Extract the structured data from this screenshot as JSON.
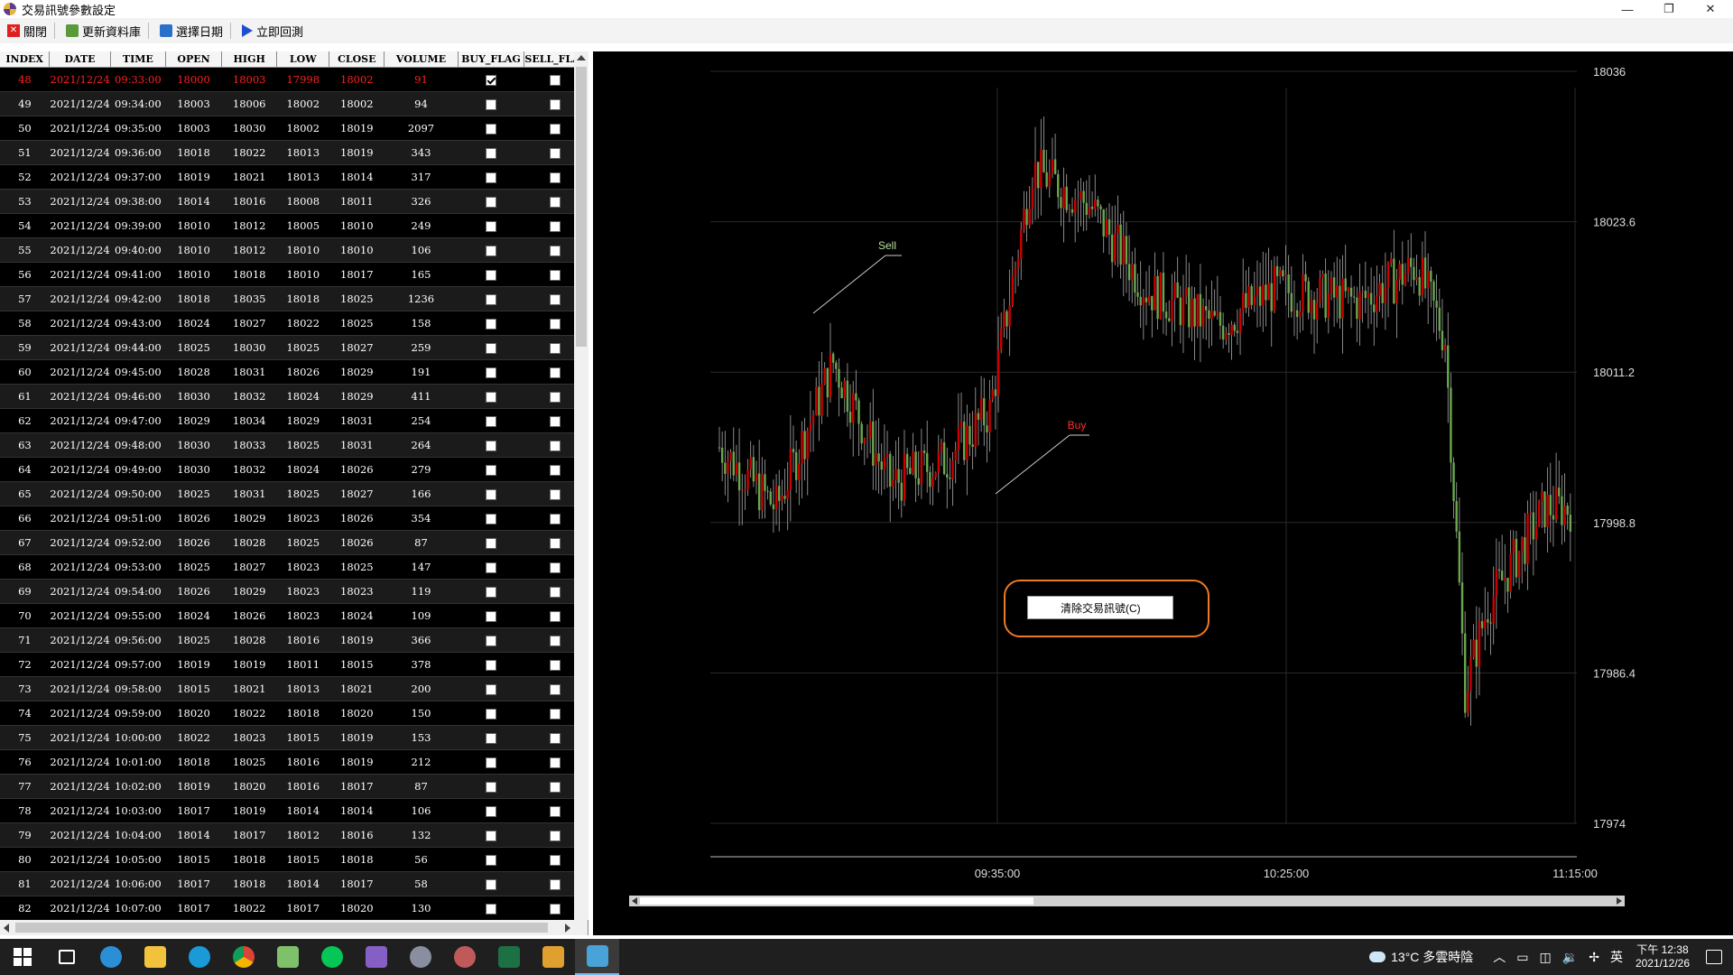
{
  "window": {
    "title": "交易訊號參數設定"
  },
  "toolbar": {
    "close_label": "關閉",
    "update_label": "更新資料庫",
    "date_label": "選擇日期",
    "backtest_label": "立即回測"
  },
  "table": {
    "columns": [
      "INDEX",
      "DATE",
      "TIME",
      "OPEN",
      "HIGH",
      "LOW",
      "CLOSE",
      "VOLUME",
      "BUY_FLAG",
      "SELL_FLAG"
    ],
    "rows": [
      [
        "48",
        "2021/12/24",
        "09:33:00",
        "18000",
        "18003",
        "17998",
        "18002",
        "91",
        true,
        false
      ],
      [
        "49",
        "2021/12/24",
        "09:34:00",
        "18003",
        "18006",
        "18002",
        "18002",
        "94",
        false,
        false
      ],
      [
        "50",
        "2021/12/24",
        "09:35:00",
        "18003",
        "18030",
        "18002",
        "18019",
        "2097",
        false,
        false
      ],
      [
        "51",
        "2021/12/24",
        "09:36:00",
        "18018",
        "18022",
        "18013",
        "18019",
        "343",
        false,
        false
      ],
      [
        "52",
        "2021/12/24",
        "09:37:00",
        "18019",
        "18021",
        "18013",
        "18014",
        "317",
        false,
        false
      ],
      [
        "53",
        "2021/12/24",
        "09:38:00",
        "18014",
        "18016",
        "18008",
        "18011",
        "326",
        false,
        false
      ],
      [
        "54",
        "2021/12/24",
        "09:39:00",
        "18010",
        "18012",
        "18005",
        "18010",
        "249",
        false,
        false
      ],
      [
        "55",
        "2021/12/24",
        "09:40:00",
        "18010",
        "18012",
        "18010",
        "18010",
        "106",
        false,
        false
      ],
      [
        "56",
        "2021/12/24",
        "09:41:00",
        "18010",
        "18018",
        "18010",
        "18017",
        "165",
        false,
        false
      ],
      [
        "57",
        "2021/12/24",
        "09:42:00",
        "18018",
        "18035",
        "18018",
        "18025",
        "1236",
        false,
        false
      ],
      [
        "58",
        "2021/12/24",
        "09:43:00",
        "18024",
        "18027",
        "18022",
        "18025",
        "158",
        false,
        false
      ],
      [
        "59",
        "2021/12/24",
        "09:44:00",
        "18025",
        "18030",
        "18025",
        "18027",
        "259",
        false,
        false
      ],
      [
        "60",
        "2021/12/24",
        "09:45:00",
        "18028",
        "18031",
        "18026",
        "18029",
        "191",
        false,
        false
      ],
      [
        "61",
        "2021/12/24",
        "09:46:00",
        "18030",
        "18032",
        "18024",
        "18029",
        "411",
        false,
        false
      ],
      [
        "62",
        "2021/12/24",
        "09:47:00",
        "18029",
        "18034",
        "18029",
        "18031",
        "254",
        false,
        false
      ],
      [
        "63",
        "2021/12/24",
        "09:48:00",
        "18030",
        "18033",
        "18025",
        "18031",
        "264",
        false,
        false
      ],
      [
        "64",
        "2021/12/24",
        "09:49:00",
        "18030",
        "18032",
        "18024",
        "18026",
        "279",
        false,
        false
      ],
      [
        "65",
        "2021/12/24",
        "09:50:00",
        "18025",
        "18031",
        "18025",
        "18027",
        "166",
        false,
        false
      ],
      [
        "66",
        "2021/12/24",
        "09:51:00",
        "18026",
        "18029",
        "18023",
        "18026",
        "354",
        false,
        false
      ],
      [
        "67",
        "2021/12/24",
        "09:52:00",
        "18026",
        "18028",
        "18025",
        "18026",
        "87",
        false,
        false
      ],
      [
        "68",
        "2021/12/24",
        "09:53:00",
        "18025",
        "18027",
        "18023",
        "18025",
        "147",
        false,
        false
      ],
      [
        "69",
        "2021/12/24",
        "09:54:00",
        "18026",
        "18029",
        "18023",
        "18023",
        "119",
        false,
        false
      ],
      [
        "70",
        "2021/12/24",
        "09:55:00",
        "18024",
        "18026",
        "18023",
        "18024",
        "109",
        false,
        false
      ],
      [
        "71",
        "2021/12/24",
        "09:56:00",
        "18025",
        "18028",
        "18016",
        "18019",
        "366",
        false,
        false
      ],
      [
        "72",
        "2021/12/24",
        "09:57:00",
        "18019",
        "18019",
        "18011",
        "18015",
        "378",
        false,
        false
      ],
      [
        "73",
        "2021/12/24",
        "09:58:00",
        "18015",
        "18021",
        "18013",
        "18021",
        "200",
        false,
        false
      ],
      [
        "74",
        "2021/12/24",
        "09:59:00",
        "18020",
        "18022",
        "18018",
        "18020",
        "150",
        false,
        false
      ],
      [
        "75",
        "2021/12/24",
        "10:00:00",
        "18022",
        "18023",
        "18015",
        "18019",
        "153",
        false,
        false
      ],
      [
        "76",
        "2021/12/24",
        "10:01:00",
        "18018",
        "18025",
        "18016",
        "18019",
        "212",
        false,
        false
      ],
      [
        "77",
        "2021/12/24",
        "10:02:00",
        "18019",
        "18020",
        "18016",
        "18017",
        "87",
        false,
        false
      ],
      [
        "78",
        "2021/12/24",
        "10:03:00",
        "18017",
        "18019",
        "18014",
        "18014",
        "106",
        false,
        false
      ],
      [
        "79",
        "2021/12/24",
        "10:04:00",
        "18014",
        "18017",
        "18012",
        "18016",
        "132",
        false,
        false
      ],
      [
        "80",
        "2021/12/24",
        "10:05:00",
        "18015",
        "18018",
        "18015",
        "18018",
        "56",
        false,
        false
      ],
      [
        "81",
        "2021/12/24",
        "10:06:00",
        "18017",
        "18018",
        "18014",
        "18017",
        "58",
        false,
        false
      ],
      [
        "82",
        "2021/12/24",
        "10:07:00",
        "18017",
        "18022",
        "18017",
        "18020",
        "130",
        false,
        false
      ]
    ]
  },
  "chart": {
    "y_ticks": [
      "18036",
      "18023.6",
      "18011.2",
      "17998.8",
      "17986.4",
      "17974"
    ],
    "x_ticks": [
      "09:35:00",
      "10:25:00",
      "11:15:00"
    ],
    "annotations": {
      "sell": "Sell",
      "buy": "Buy"
    },
    "colors": {
      "up": "#cc0000",
      "down": "#6aa84f",
      "sell": "#b6e3a0",
      "buy": "#ff3030"
    }
  },
  "chart_data": {
    "type": "candlestick",
    "x_ticks": [
      "09:35:00",
      "10:25:00",
      "11:15:00"
    ],
    "ylim": [
      17974,
      18036
    ],
    "y_ticks": [
      18036,
      18023.6,
      18011.2,
      17998.8,
      17986.4,
      17974
    ],
    "annotations": [
      "Sell",
      "Buy"
    ]
  },
  "context_menu": {
    "item": "清除交易訊號(C)"
  },
  "taskbar": {
    "weather": "13°C  多雲時陰",
    "ime": "英",
    "time": "下午 12:38",
    "date": "2021/12/26"
  }
}
